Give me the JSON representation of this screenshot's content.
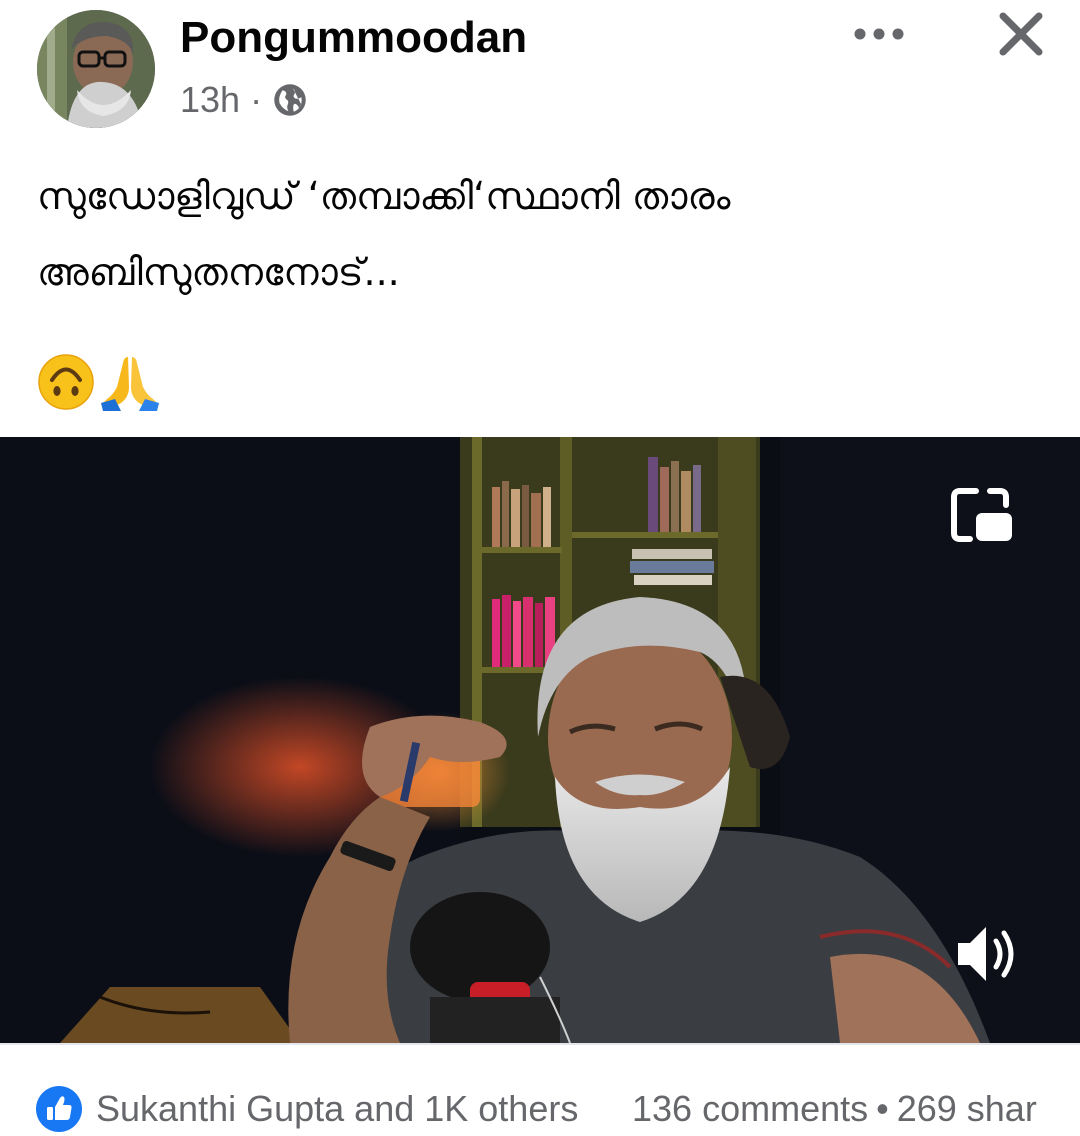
{
  "post": {
    "author": "Pongummoodan",
    "time": "13h",
    "separator": "·",
    "privacy_icon": "globe-icon",
    "text_line1": "സുഡോളിവുഡ് ‘തമ്പാക്കി‘സ്ഥാനി താരം",
    "text_line2": "അബിസുതനനോട്...",
    "emojis": [
      "upside-down-face",
      "folded-hands"
    ],
    "emoji_chars": {
      "upside_down_face": "🙃",
      "folded_hands": "🙏"
    }
  },
  "header_actions": {
    "more_icon": "more-horizontal-icon",
    "close_icon": "close-icon"
  },
  "video": {
    "pip_icon": "picture-in-picture-icon",
    "volume_icon": "volume-icon"
  },
  "footer": {
    "reactions_text": "Sukanthi Gupta and 1K others",
    "comments_text": "136 comments",
    "separator": "•",
    "shares_text": "269 shar",
    "reaction_icon": "like-reaction-icon"
  },
  "colors": {
    "text_primary": "#050505",
    "text_secondary": "#65676b",
    "like_blue": "#1877f2"
  }
}
